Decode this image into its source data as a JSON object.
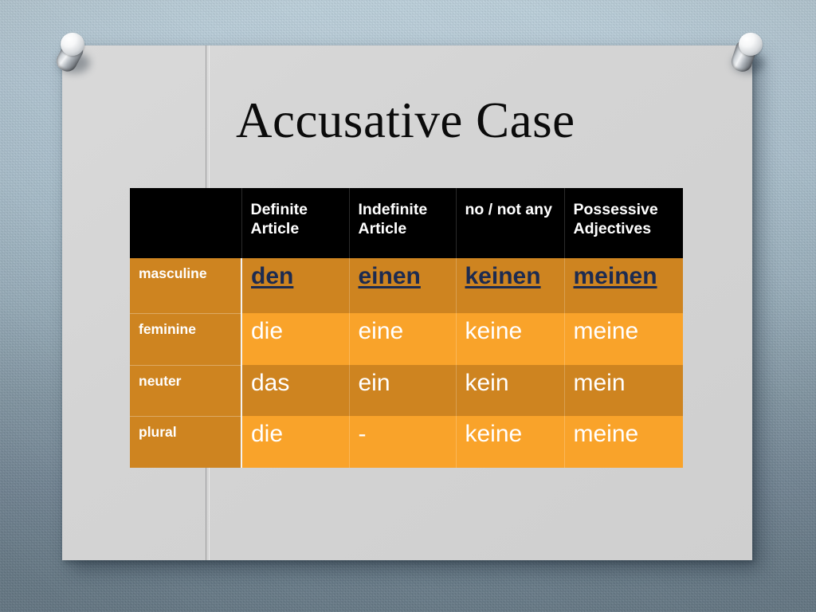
{
  "slide": {
    "title": "Accusative Case",
    "background_color": "#d6d6d6",
    "wall_color_top": "#bdd2de",
    "wall_color_bottom": "#6a808f"
  },
  "pins": [
    {
      "name": "pushpin-left"
    },
    {
      "name": "pushpin-right"
    }
  ],
  "table": {
    "header_background": "#000000",
    "row_label_background": "#ce8420",
    "row_dark_background": "#ce8420",
    "row_light_background": "#f9a32a",
    "masculine_text_color": "#1d2b50",
    "headers": [
      "",
      "Definite Article",
      "Indefinite Article",
      "no / not any",
      "Possessive Adjectives"
    ],
    "rows": [
      {
        "label": "masculine",
        "cells": [
          "den",
          "einen",
          "keinen",
          "meinen"
        ]
      },
      {
        "label": "feminine",
        "cells": [
          "die",
          "eine",
          "keine",
          "meine"
        ]
      },
      {
        "label": "neuter",
        "cells": [
          "das",
          "ein",
          "kein",
          "mein"
        ]
      },
      {
        "label": "plural",
        "cells": [
          "die",
          "-",
          "keine",
          "meine"
        ]
      }
    ]
  }
}
